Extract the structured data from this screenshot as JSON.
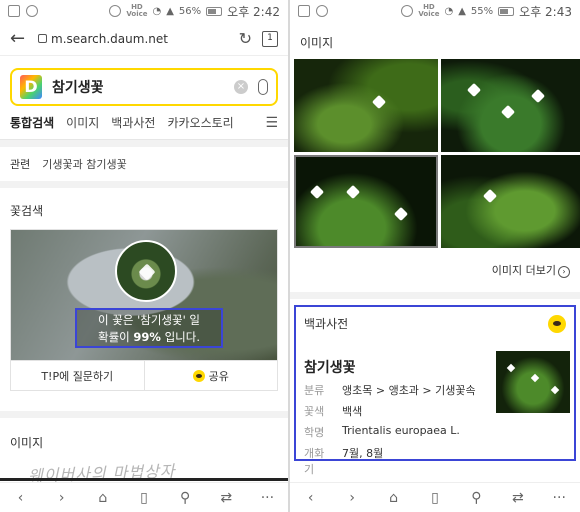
{
  "left": {
    "status": {
      "battery": "56%",
      "time": "오후 2:42",
      "hd": "HD",
      "voice": "Voice"
    },
    "urlbar": {
      "url": "m.search.daum.net",
      "tab_count": "1"
    },
    "search": {
      "logo": "D",
      "query": "참기생꽃",
      "clear": "×"
    },
    "tabs": [
      "통합검색",
      "이미지",
      "백과사전",
      "카카오스토리"
    ],
    "related": {
      "label": "관련",
      "value": "기생꽃과 참기생꽃"
    },
    "flower_search": {
      "title": "꽃검색",
      "result_line1": "이 꽃은 '참기생꽃' 일",
      "result_line2_pre": "확률이 ",
      "result_percent": "99%",
      "result_line2_post": " 입니다.",
      "ask_button": "T!P에 질문하기",
      "share_button": "공유"
    },
    "images_title": "이미지",
    "watermark": "웨이버사의 마법상자"
  },
  "right": {
    "status": {
      "battery": "55%",
      "time": "오후 2:43",
      "hd": "HD",
      "voice": "Voice"
    },
    "images_title": "이미지",
    "more_images": "이미지 더보기",
    "dict": {
      "section": "백과사전",
      "name": "참기생꽃",
      "rows": [
        {
          "label": "분류",
          "value": "앵초목 > 앵초과 > 기생꽃속"
        },
        {
          "label": "꽃색",
          "value": "백색"
        },
        {
          "label": "학명",
          "value": "Trientalis europaea L."
        },
        {
          "label": "개화기",
          "value": "7월, 8월"
        }
      ]
    }
  },
  "icons": {
    "back": "←",
    "forward": "›",
    "home": "⌂",
    "bookmark": "▯",
    "search": "⚲",
    "share": "⇄",
    "more": "···",
    "reload": "↻",
    "filter": "☰"
  },
  "colors": {
    "accent_yellow": "#ffd800",
    "highlight_blue": "#3b45d6"
  }
}
